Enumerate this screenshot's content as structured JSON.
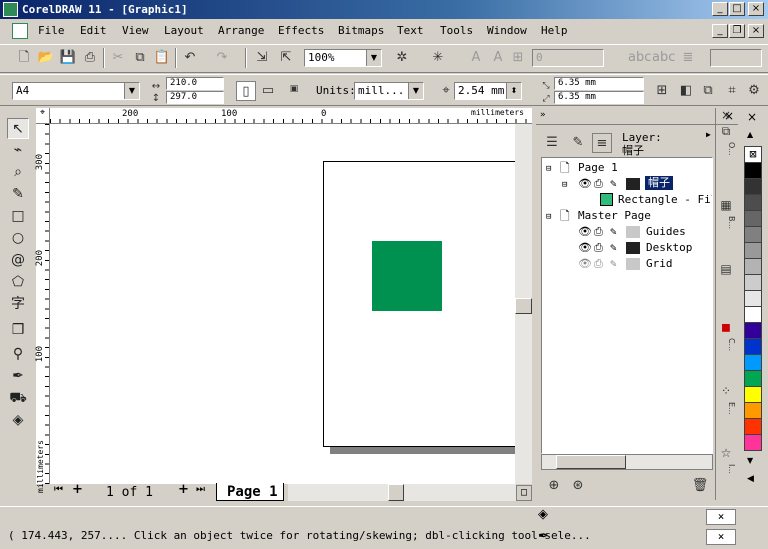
{
  "window": {
    "title": "CorelDRAW 11 - [Graphic1]",
    "btn_min": "_",
    "btn_max": "□",
    "btn_close": "×"
  },
  "menu": {
    "items": [
      "File",
      "Edit",
      "View",
      "Layout",
      "Arrange",
      "Effects",
      "Bitmaps",
      "Text",
      "Tools",
      "Window",
      "Help"
    ],
    "mdi_min": "_",
    "mdi_restore": "❐",
    "mdi_close": "×"
  },
  "standard_toolbar": {
    "zoom_value": "100%",
    "font_size_value": "0"
  },
  "property_bar": {
    "paper_size": "A4",
    "width_value": "210.0",
    "height_value": "297.0",
    "units_label": "Units:",
    "units_value": "mill...",
    "nudge_value": "2.54 mm",
    "dup_x_value": "6.35 mm",
    "dup_y_value": "6.35 mm"
  },
  "rulers": {
    "h_ticks": [
      "200",
      "100",
      "0"
    ],
    "h_units": "millimeters",
    "v_ticks": [
      "300",
      "200",
      "100"
    ],
    "v_units": "millimeters"
  },
  "page_nav": {
    "counter": "1 of 1",
    "tab_label": "Page 1"
  },
  "docker": {
    "layer_label": "Layer:",
    "layer_name": "帽子",
    "tree": {
      "page": "Page 1",
      "layer": "帽子",
      "object": "Rectangle - Fill",
      "master": "Master Page",
      "guides": "Guides",
      "desktop": "Desktop",
      "grid": "Grid"
    },
    "side_tabs": [
      "O...",
      "B...",
      "C...",
      "E...",
      "I..."
    ]
  },
  "status": {
    "text": "( 174.443, 257.... Click an object twice for rotating/skewing; dbl-clicking tool sele..."
  },
  "colors": {
    "rectangle": "#009150",
    "titlebar": "#0a246a",
    "palette": [
      "#000000",
      "#333333",
      "#4d4d4d",
      "#666666",
      "#808080",
      "#999999",
      "#b3b3b3",
      "#cccccc",
      "#e6e6e6",
      "#ffffff",
      "#330099",
      "#0033cc",
      "#0099ff",
      "#00a651",
      "#ffff00",
      "#ff9900",
      "#ff3300",
      "#ff3399"
    ]
  }
}
